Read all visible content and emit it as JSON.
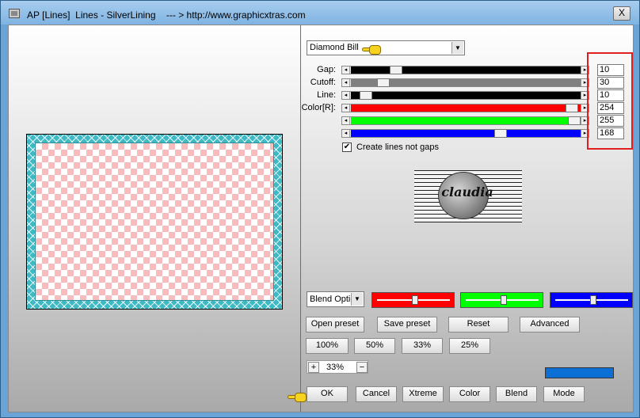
{
  "window": {
    "title": "AP [Lines]  Lines - SilverLining    --- > http://www.graphicxtras.com",
    "close_label": "X"
  },
  "preset": {
    "selected": "Diamond Bill"
  },
  "sliders": [
    {
      "label": "Gap:",
      "value": "10",
      "fill_color": "#000000",
      "position_fraction": 0.18
    },
    {
      "label": "Cutoff:",
      "value": "30",
      "fill_color": "#808080",
      "position_fraction": 0.12
    },
    {
      "label": "Line:",
      "value": "10",
      "fill_color": "#000000",
      "position_fraction": 0.04
    },
    {
      "label": "Color[R]:",
      "value": "254",
      "fill_color": "#ff0000",
      "position_fraction": 0.99
    },
    {
      "label": "",
      "value": "255",
      "fill_color": "#00ff00",
      "position_fraction": 1.0
    },
    {
      "label": "",
      "value": "168",
      "fill_color": "#0000ff",
      "position_fraction": 0.66
    }
  ],
  "checkbox": {
    "label": "Create lines not gaps",
    "checked": true,
    "mark": "✔"
  },
  "logo": {
    "text": "claudia"
  },
  "blend": {
    "selected": "Blend Options"
  },
  "mini_sliders": [
    {
      "color": "#ff0000",
      "position_fraction": 0.5
    },
    {
      "color": "#00ff00",
      "position_fraction": 0.5
    },
    {
      "color": "#0000ff",
      "position_fraction": 0.5
    }
  ],
  "buttons": {
    "open_preset": "Open preset",
    "save_preset": "Save preset",
    "reset": "Reset",
    "advanced": "Advanced",
    "zoom_100": "100%",
    "zoom_50": "50%",
    "zoom_33": "33%",
    "zoom_25": "25%",
    "ok": "OK",
    "cancel": "Cancel",
    "xtreme": "Xtreme",
    "color": "Color",
    "blend": "Blend",
    "mode": "Mode"
  },
  "zoom": {
    "plus": "+",
    "value": "33%",
    "minus": "−"
  },
  "output_color": "#0b6fd6",
  "icons": {
    "arrow_left": "◂",
    "arrow_right": "▸",
    "dropdown": "▼",
    "pointer_hand": "pointing-hand-icon"
  }
}
